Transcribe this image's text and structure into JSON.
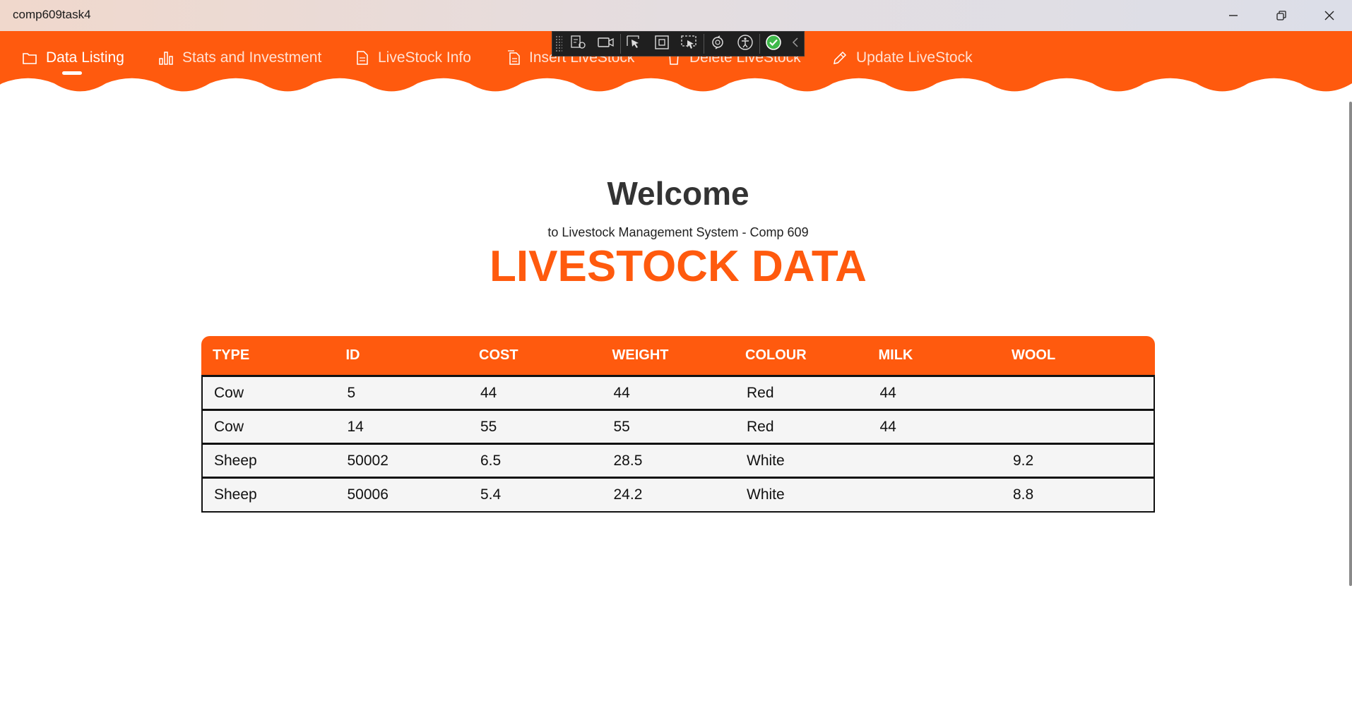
{
  "window": {
    "title": "comp609task4",
    "minimize_icon": "minimize-icon",
    "restore_icon": "restore-icon",
    "close_icon": "close-icon"
  },
  "colors": {
    "accent": "#ff5a0e",
    "heading": "#333333",
    "row_bg": "#f5f5f5"
  },
  "nav": {
    "items": [
      {
        "label": "Data Listing",
        "icon": "folder-icon",
        "active": true
      },
      {
        "label": "Stats and Investment",
        "icon": "bar-chart-icon",
        "active": false
      },
      {
        "label": "LiveStock Info",
        "icon": "document-icon",
        "active": false
      },
      {
        "label": "Insert LiveStock",
        "icon": "documents-icon",
        "active": false
      },
      {
        "label": "Delete LiveStock",
        "icon": "trash-icon",
        "active": false
      },
      {
        "label": "Update LiveStock",
        "icon": "pencil-icon",
        "active": false
      }
    ]
  },
  "devtools": {
    "icons": [
      "live-visual-tree-icon",
      "record-icon",
      "select-element-icon",
      "display-layout-adorners-icon",
      "track-focus-icon",
      "hot-reload-icon",
      "accessibility-icon",
      "checkmark-icon",
      "collapse-chevron-icon"
    ]
  },
  "header": {
    "welcome": "Welcome",
    "subtitle": "to Livestock Management System - Comp 609",
    "title": "LIVESTOCK DATA"
  },
  "table": {
    "columns": [
      "TYPE",
      "ID",
      "COST",
      "WEIGHT",
      "COLOUR",
      "MILK",
      "WOOL"
    ],
    "rows": [
      [
        "Cow",
        "5",
        "44",
        "44",
        "Red",
        "44",
        ""
      ],
      [
        "Cow",
        "14",
        "55",
        "55",
        "Red",
        "44",
        ""
      ],
      [
        "Sheep",
        "50002",
        "6.5",
        "28.5",
        "White",
        "",
        "9.2"
      ],
      [
        "Sheep",
        "50006",
        "5.4",
        "24.2",
        "White",
        "",
        "8.8"
      ]
    ]
  }
}
